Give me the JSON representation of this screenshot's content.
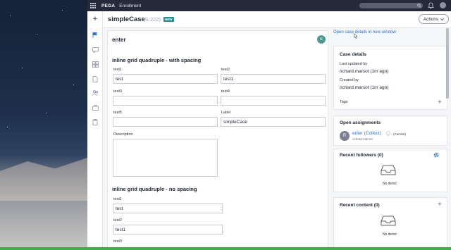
{
  "header": {
    "brand": "PEGA",
    "app_name": "Enrollment"
  },
  "case": {
    "title": "simpleCase",
    "id": "(S-222)",
    "badge": "NEW",
    "actions_label": "Actions"
  },
  "form": {
    "step_title": "enter",
    "avatar_initial": "R",
    "section1": {
      "title": "inline grid quadruple - with spacing",
      "fields": [
        {
          "label": "test1",
          "value": "test"
        },
        {
          "label": "test2",
          "value": "test1"
        },
        {
          "label": "test3",
          "value": ""
        },
        {
          "label": "test4",
          "value": ""
        },
        {
          "label": "test5",
          "value": ""
        },
        {
          "label": "Label",
          "value": "simpleCase"
        }
      ],
      "description_label": "Description"
    },
    "section2": {
      "title": "inline grid quadruple - no spacing",
      "fields": [
        {
          "label": "test1",
          "value": "test"
        },
        {
          "label": "test2",
          "value": "test1"
        },
        {
          "label": "test3",
          "value": ""
        }
      ]
    }
  },
  "right_panel": {
    "open_link": "Open case details in new window",
    "case_details": {
      "title": "Case details",
      "last_updated_label": "Last updated by",
      "last_updated_value": "richard.marsot (1m ago)",
      "created_label": "Created by",
      "created_value": "richard.marsot (1m ago)",
      "tags_label": "Tags"
    },
    "assignments": {
      "title": "Open assignments",
      "item_initial": "R",
      "item_name": "enter (Collect)",
      "item_status": "(Current)",
      "item_user": "richard.marsot"
    },
    "followers": {
      "title": "Recent followers (0)",
      "empty": "No items"
    },
    "content": {
      "title": "Recent content (0)",
      "empty": "No items"
    }
  },
  "icons": [
    "app-grid-icon",
    "search-icon",
    "bell-icon",
    "user-icon",
    "plus-icon",
    "flag-icon",
    "chat-icon",
    "dashboard-icon",
    "document-icon",
    "users-icon",
    "briefcase-icon",
    "clipboard-icon",
    "chevron-down-icon",
    "gear-icon",
    "inbox-tray-icon",
    "info-icon",
    "cursor-icon"
  ],
  "colors": {
    "topbar": "#25293a",
    "link": "#2a6fcf",
    "badge": "#2a8c8c",
    "avatar": "#4c9a8e",
    "taskbar": "#3fae4a"
  }
}
